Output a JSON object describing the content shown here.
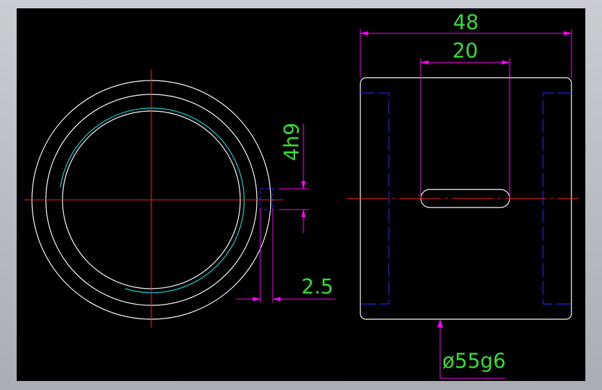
{
  "drawing": {
    "dimensions": {
      "overall_width": "48",
      "slot_width": "20",
      "slot_tolerance": "4h9",
      "wall_offset": "2.5",
      "outer_diameter": "ø55g6"
    },
    "colors": {
      "background": "#000000",
      "frame": "#b4b7bd",
      "geometry": "#ffffff",
      "centerline": "#ff2020",
      "dimension": "#ff00ff",
      "dimension_text": "#33dd33",
      "hidden": "#2020ff",
      "thread": "#00d7d7"
    }
  }
}
